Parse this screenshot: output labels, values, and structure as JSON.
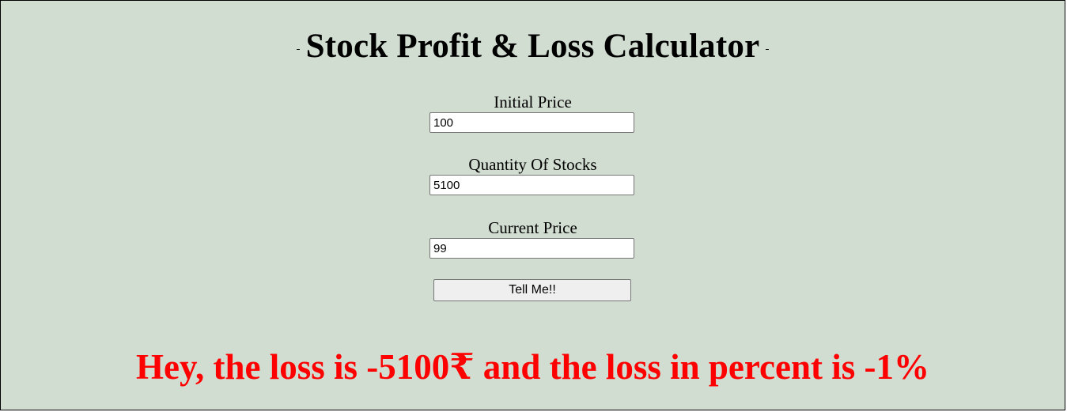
{
  "header": {
    "title": "Stock Profit & Loss Calculator"
  },
  "form": {
    "initial_price": {
      "label": "Initial Price",
      "value": "100"
    },
    "quantity": {
      "label": "Quantity Of Stocks",
      "value": "5100"
    },
    "current_price": {
      "label": "Current Price",
      "value": "99"
    },
    "submit_label": "Tell Me!!"
  },
  "output": {
    "message": "Hey, the loss is -5100₹ and the loss in percent is -1%",
    "color": "#ff0000"
  },
  "theme": {
    "background": "#d2ddd1"
  }
}
